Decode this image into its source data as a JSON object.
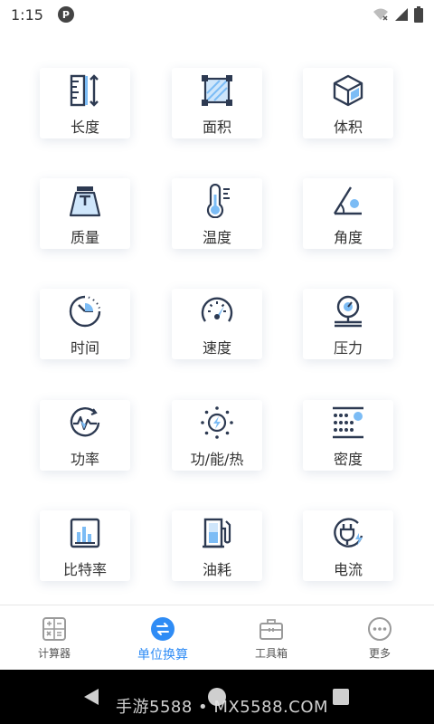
{
  "status_bar": {
    "time": "1:15",
    "app_icon_glyph": "P"
  },
  "grid": {
    "tiles": [
      {
        "label": "长度",
        "icon": "ruler-icon"
      },
      {
        "label": "面积",
        "icon": "area-icon"
      },
      {
        "label": "体积",
        "icon": "cube-icon"
      },
      {
        "label": "质量",
        "icon": "weight-icon"
      },
      {
        "label": "温度",
        "icon": "thermometer-icon"
      },
      {
        "label": "角度",
        "icon": "angle-icon"
      },
      {
        "label": "时间",
        "icon": "clock-icon"
      },
      {
        "label": "速度",
        "icon": "speedometer-icon"
      },
      {
        "label": "压力",
        "icon": "pressure-gauge-icon"
      },
      {
        "label": "功率",
        "icon": "power-icon"
      },
      {
        "label": "功/能/热",
        "icon": "energy-icon"
      },
      {
        "label": "密度",
        "icon": "density-icon"
      },
      {
        "label": "比特率",
        "icon": "bitrate-icon"
      },
      {
        "label": "油耗",
        "icon": "fuel-icon"
      },
      {
        "label": "电流",
        "icon": "plug-icon"
      }
    ]
  },
  "tabbar": {
    "tabs": [
      {
        "label": "计算器",
        "icon": "calculator-icon",
        "active": false
      },
      {
        "label": "单位换算",
        "icon": "convert-icon",
        "active": true
      },
      {
        "label": "工具箱",
        "icon": "toolbox-icon",
        "active": false
      },
      {
        "label": "更多",
        "icon": "more-icon",
        "active": false
      }
    ]
  },
  "navbar": {
    "watermark": "手游5588 • MX5588.COM"
  },
  "colors": {
    "accent": "#2f8cf5",
    "icon_dark": "#2d3a52",
    "icon_light": "#7cbcf5",
    "text": "#333333"
  }
}
